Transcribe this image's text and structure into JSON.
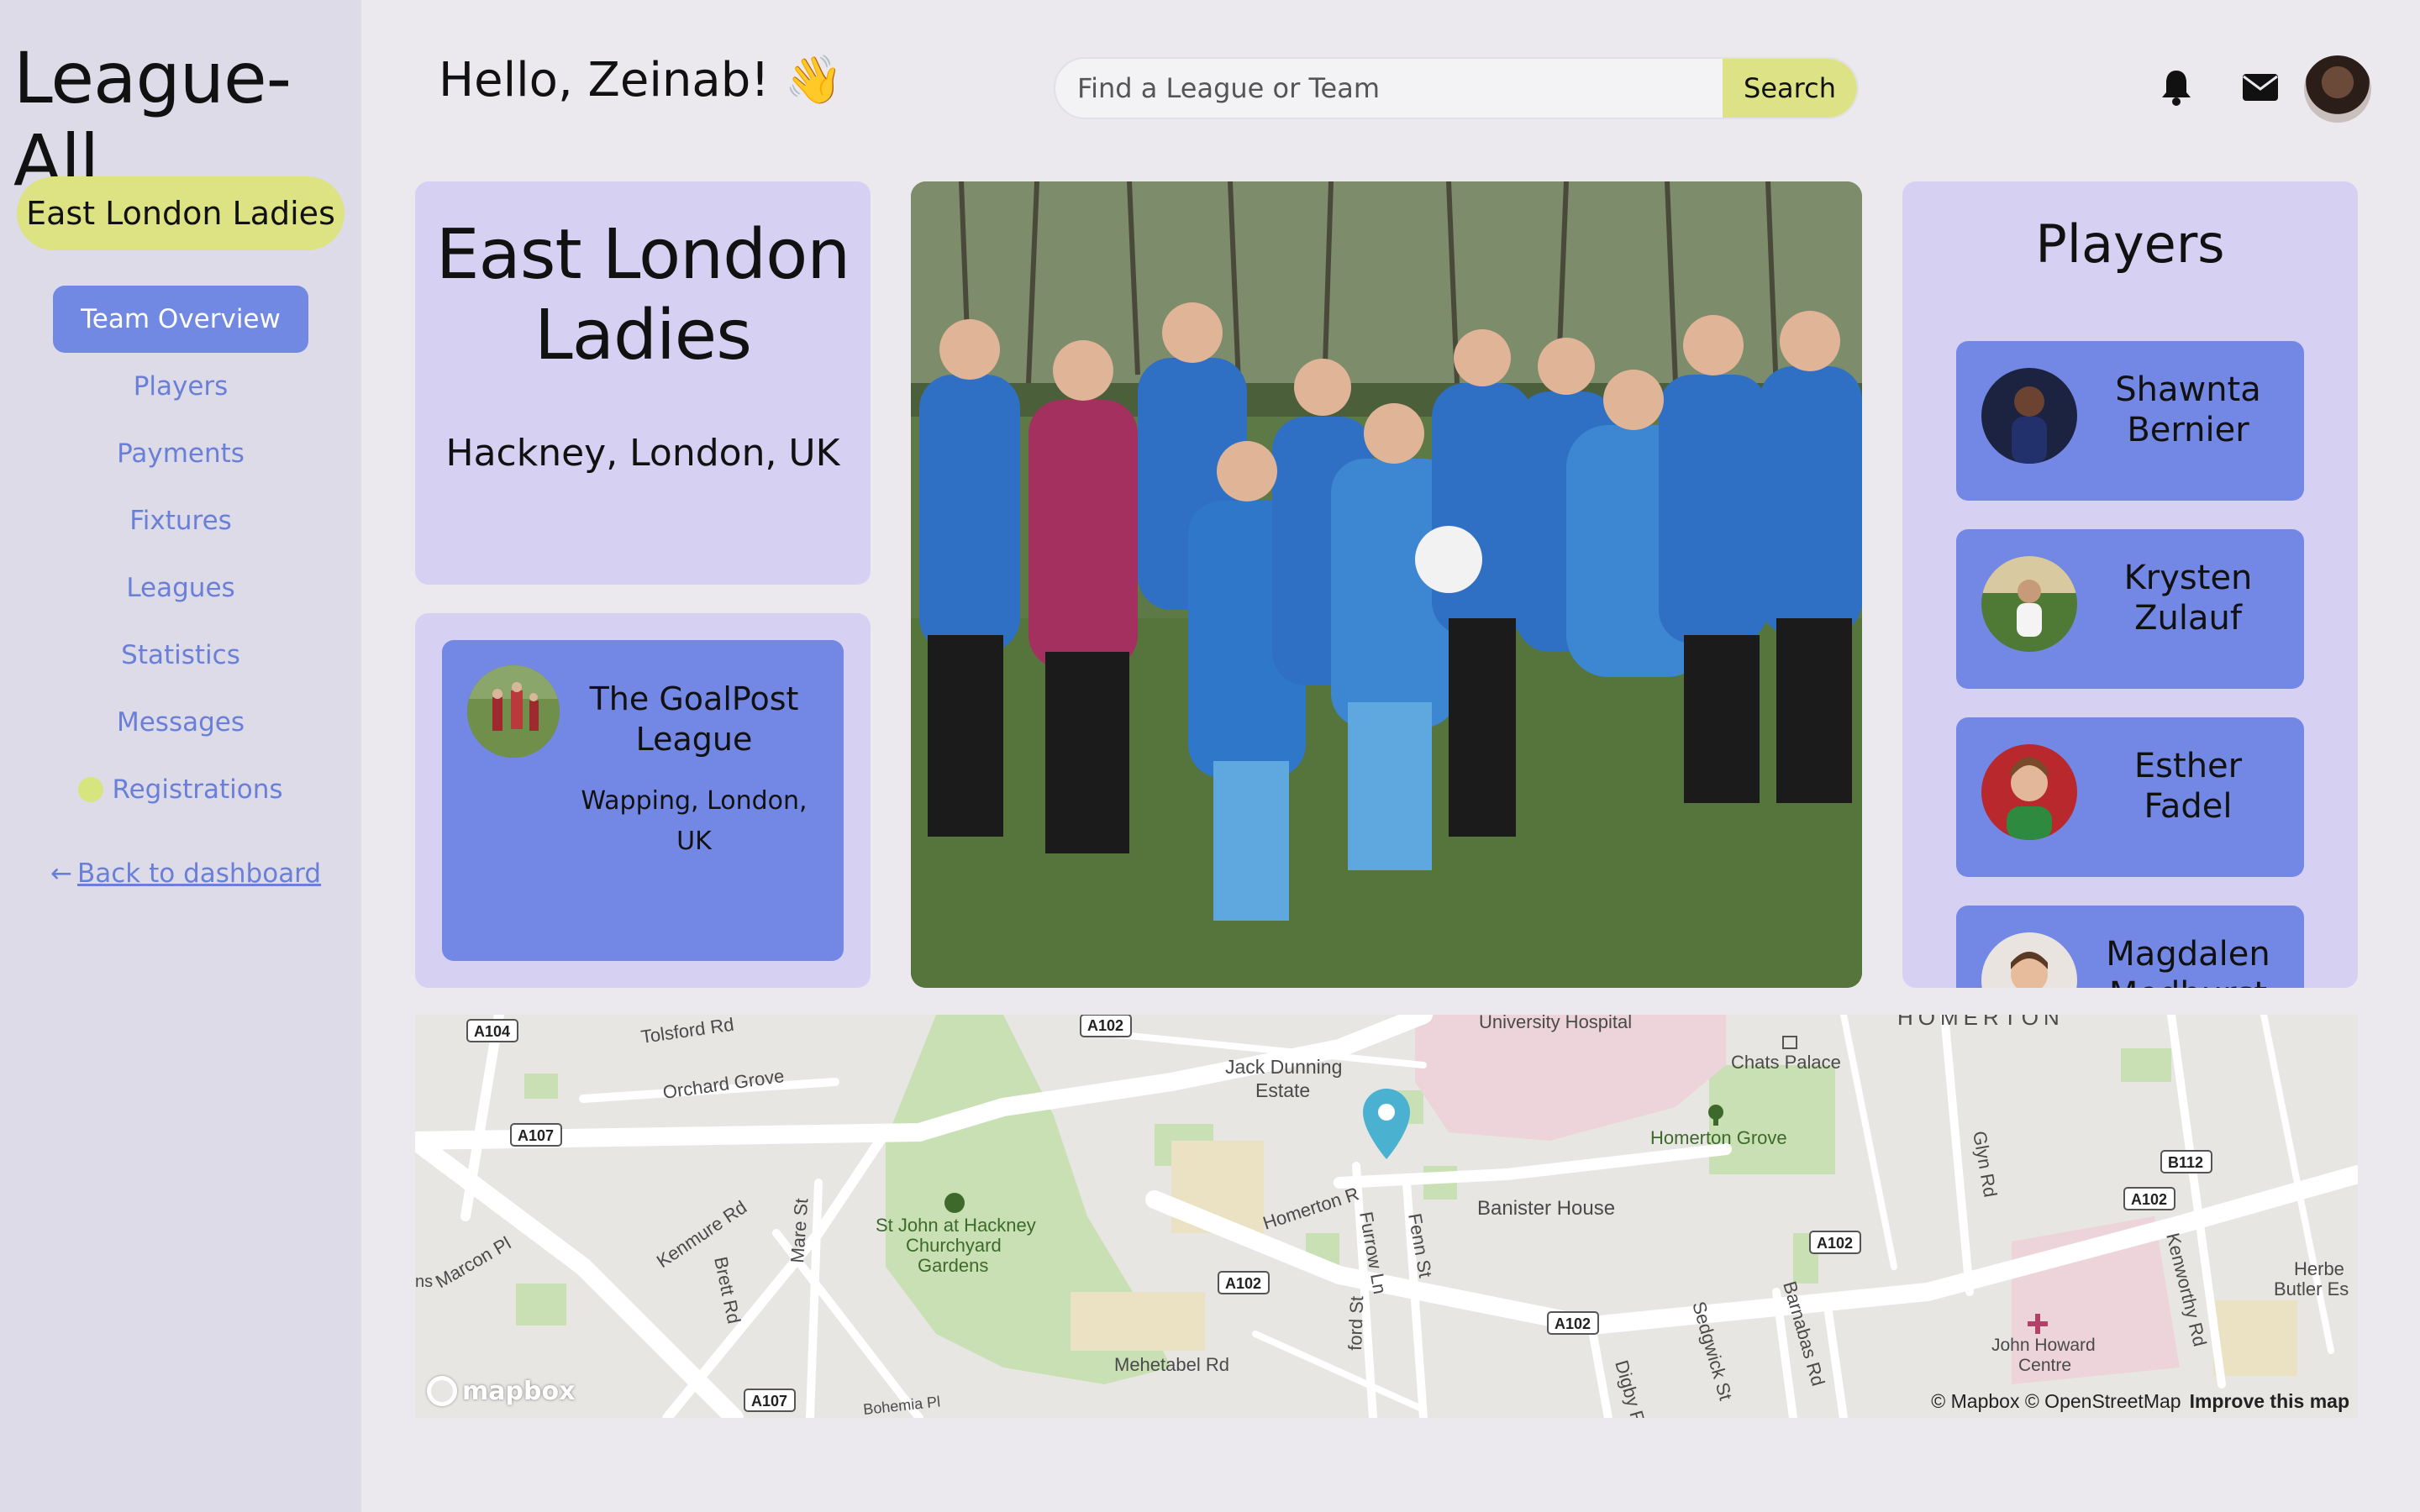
{
  "app": {
    "logo": "League-All"
  },
  "sidebar": {
    "team_pill": "East London Ladies",
    "active_item": "Team Overview",
    "items": [
      {
        "label": "Players"
      },
      {
        "label": "Payments"
      },
      {
        "label": "Fixtures"
      },
      {
        "label": "Leagues"
      },
      {
        "label": "Statistics"
      },
      {
        "label": "Messages"
      },
      {
        "label": "Registrations"
      }
    ],
    "back_link": "Back to dashboard",
    "back_arrow": "←",
    "registrations_dot_color": "#d6e57d"
  },
  "header": {
    "greeting": "Hello, Zeinab! 👋",
    "search_placeholder": "Find a League or Team",
    "search_button": "Search",
    "icons": [
      "bell-icon",
      "mail-icon"
    ]
  },
  "team": {
    "name": "East London Ladies",
    "location": "Hackney, London, UK"
  },
  "league": {
    "name": "The GoalPost League",
    "location": "Wapping, London, UK"
  },
  "players": {
    "title": "Players",
    "list": [
      {
        "name": "Shawnta Bernier"
      },
      {
        "name": "Krysten Zulauf"
      },
      {
        "name": "Esther Fadel"
      },
      {
        "name": "Magdalen Medhurst"
      }
    ]
  },
  "map": {
    "labels": {
      "tolsford": "Tolsford Rd",
      "orchard": "Orchard Grove",
      "a104": "A104",
      "a107a": "A107",
      "a107b": "A107",
      "a102a": "A102",
      "a102b": "A102",
      "a102c": "A102",
      "a102d": "A102",
      "a102e": "A102",
      "b112": "B112",
      "university": "University Hospital",
      "homerton_top": "HOMERTON",
      "chats": "Chats Palace",
      "jack": "Jack Dunning",
      "jack2": "Estate",
      "homerton_grove": "Homerton Grove",
      "glyn": "Glyn Rd",
      "banister": "Banister House",
      "homerton_rd": "Homerton R",
      "furrow": "Furrow Ln",
      "fenn": "Fenn St",
      "kenmure": "Kenmure Rd",
      "brett": "Brett Rd",
      "mare": "Mare St",
      "marcon": "Marcon Pl",
      "stjohn1": "St John at Hackney",
      "stjohn2": "Churchyard",
      "stjohn3": "Gardens",
      "mehetabel": "Mehetabel Rd",
      "sedgwick": "Sedgwick St",
      "barnabas": "Barnabas Rd",
      "digby": "Digby R",
      "ford": "ford St",
      "kenworthy": "Kenworthy Rd",
      "herbert1": "Herbe",
      "herbert2": "Butler Es",
      "john1": "John Howard",
      "john2": "Centre",
      "ns": "ns",
      "bohemia": "Bohemia Pl"
    },
    "attribution": "© Mapbox © OpenStreetMap",
    "improve": "Improve this map",
    "logo": "mapbox"
  },
  "colors": {
    "accent": "#7189e2",
    "pill": "#dde283",
    "card": "#d6d0f2",
    "sidebar": "#dddbe8"
  }
}
